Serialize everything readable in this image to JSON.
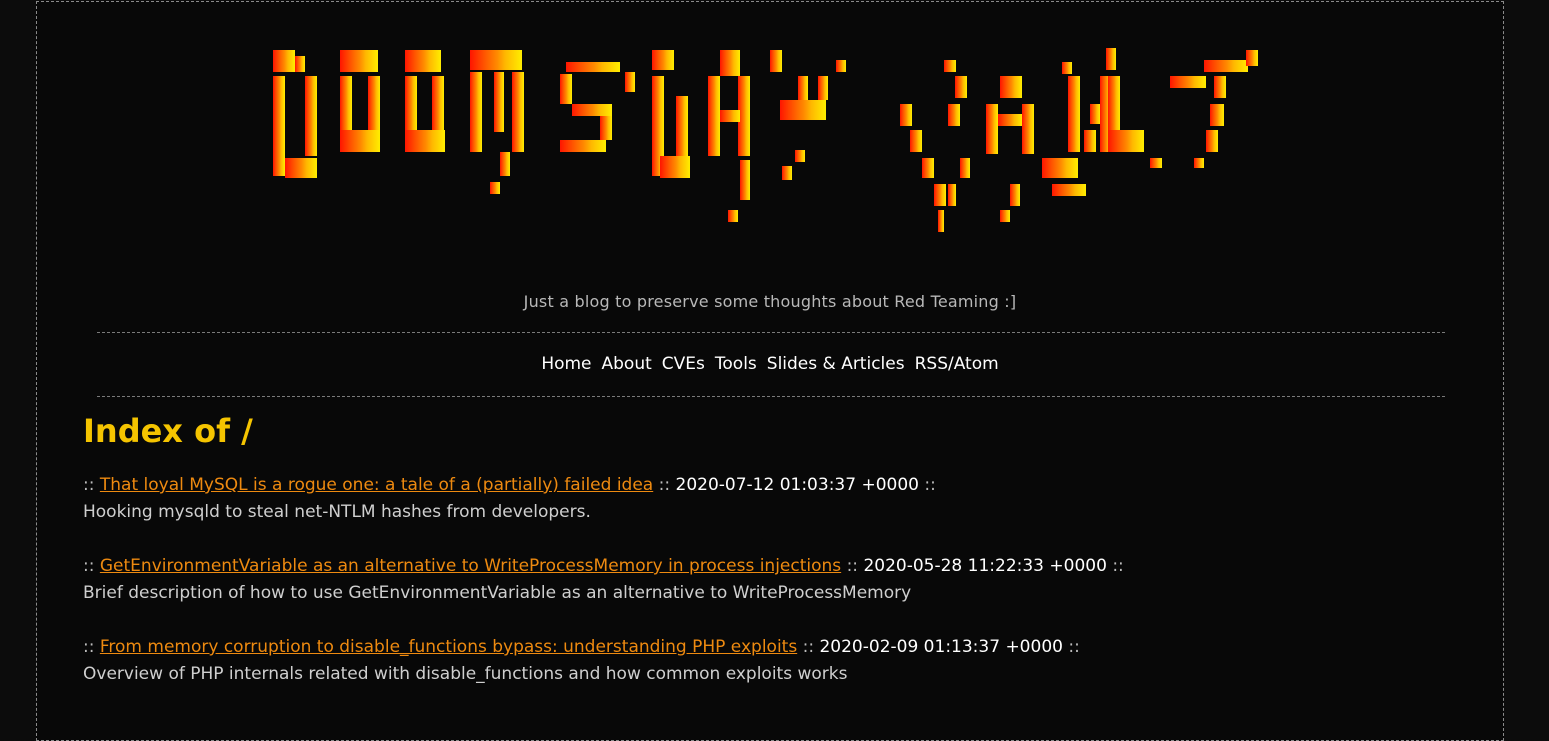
{
  "banner": {
    "title": "DOOMSDAY VAULT",
    "gradient_colors": [
      "#ff1500",
      "#ff6a00",
      "#ffb000",
      "#ffee00"
    ]
  },
  "tagline": "Just a blog to preserve some thoughts about Red Teaming :]",
  "nav": {
    "items": [
      "Home",
      "About",
      "CVEs",
      "Tools",
      "Slides & Articles",
      "RSS/Atom"
    ]
  },
  "heading": "Index of /",
  "posts": [
    {
      "prefix": "::",
      "title": "That loyal MySQL is a rogue one: a tale of a (partially) failed idea",
      "mid": "::",
      "date": "2020-07-12 01:03:37 +0000",
      "suffix": "::",
      "description": "Hooking mysqld to steal net-NTLM hashes from developers."
    },
    {
      "prefix": "::",
      "title": "GetEnvironmentVariable as an alternative to WriteProcessMemory in process injections",
      "mid": "::",
      "date": "2020-05-28 11:22:33 +0000",
      "suffix": "::",
      "description": "Brief description of how to use GetEnvironmentVariable as an alternative to WriteProcessMemory"
    },
    {
      "prefix": "::",
      "title": "From memory corruption to disable_functions bypass: understanding PHP exploits",
      "mid": "::",
      "date": "2020-02-09 01:13:37 +0000",
      "suffix": "::",
      "description": "Overview of PHP internals related with disable_functions and how common exploits works"
    }
  ],
  "colors": {
    "background": "#0c0c0c",
    "link": "#ee8a10",
    "heading": "#f5c400",
    "text": "#cfcfcf"
  }
}
